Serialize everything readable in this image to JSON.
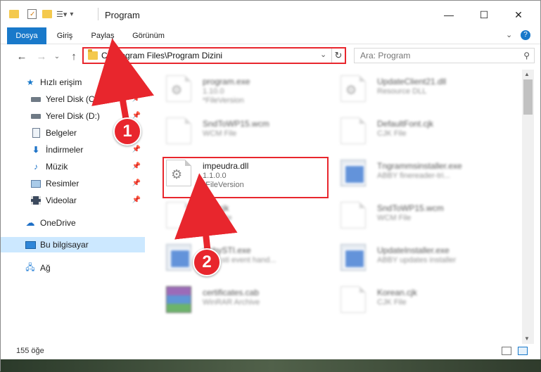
{
  "window": {
    "title": "Program",
    "controls": {
      "minimize": "—",
      "maximize": "☐",
      "close": "✕"
    }
  },
  "ribbon": {
    "tabs": [
      {
        "label": "Dosya",
        "active": true
      },
      {
        "label": "Giriş"
      },
      {
        "label": "Paylaş"
      },
      {
        "label": "Görünüm"
      }
    ]
  },
  "address": {
    "path": "C:\\Program Files\\Program Dizini",
    "search_placeholder": "Ara: Program"
  },
  "navpane": {
    "items": [
      {
        "label": "Hızlı erişim",
        "icon": "star-icon"
      },
      {
        "label": "Yerel Disk (C:)",
        "icon": "drive-icon",
        "pinned": true
      },
      {
        "label": "Yerel Disk (D:)",
        "icon": "drive-icon",
        "pinned": true
      },
      {
        "label": "Belgeler",
        "icon": "documents-icon",
        "pinned": true
      },
      {
        "label": "İndirmeler",
        "icon": "downloads-icon",
        "pinned": true
      },
      {
        "label": "Müzik",
        "icon": "music-icon",
        "pinned": true
      },
      {
        "label": "Resimler",
        "icon": "pictures-icon",
        "pinned": true
      },
      {
        "label": "Videolar",
        "icon": "videos-icon",
        "pinned": true
      },
      {
        "label": "OneDrive",
        "icon": "cloud-icon"
      },
      {
        "label": "Bu bilgisayar",
        "icon": "computer-icon",
        "selected": true
      },
      {
        "label": "Ağ",
        "icon": "network-icon"
      }
    ]
  },
  "files": [
    {
      "name": "program.exe",
      "l2": "1.10.0",
      "l3": "*FileVersion",
      "icon": "gear-file",
      "blur": true
    },
    {
      "name": "UpdateClient21.dll",
      "l2": "Resource DLL",
      "l3": "",
      "icon": "gear-file",
      "blur": true
    },
    {
      "name": "SndToWP15.wcm",
      "l2": "WCM File",
      "l3": "",
      "icon": "doc",
      "blur": true
    },
    {
      "name": "DefaultFont.cjk",
      "l2": "CJK File",
      "l3": "",
      "icon": "doc",
      "blur": true
    },
    {
      "name": "impeudra.dll",
      "l2": "1.1.0.0",
      "l3": "*FileVersion",
      "icon": "gear-file",
      "blur": false
    },
    {
      "name": "Tngrammsinstaller.exe",
      "l2": "ABBY finereader-tri...",
      "l3": "",
      "icon": "exe",
      "blur": true
    },
    {
      "name": "Fist.cjk",
      "l2": "CJK File",
      "l3": "",
      "icon": "doc",
      "blur": true
    },
    {
      "name": "SndToWP15.wcm",
      "l2": "WCM File",
      "l3": "",
      "icon": "doc",
      "blur": true
    },
    {
      "name": "AbbySTI.exe",
      "l2": "abby sti event hand...",
      "l3": "",
      "icon": "exe",
      "blur": true
    },
    {
      "name": "UpdateInstaller.exe",
      "l2": "ABBY updates installer",
      "l3": "",
      "icon": "exe",
      "blur": true
    },
    {
      "name": "certificates.cab",
      "l2": "WinRAR Archive",
      "l3": "",
      "icon": "rar",
      "blur": true
    },
    {
      "name": "Korean.cjk",
      "l2": "CJK File",
      "l3": "",
      "icon": "doc",
      "blur": true
    }
  ],
  "status": {
    "count": "155 öğe"
  },
  "callouts": {
    "one": "1",
    "two": "2"
  },
  "colors": {
    "accent": "#1979ca",
    "highlight": "#e8262d",
    "selection": "#cce8ff"
  }
}
